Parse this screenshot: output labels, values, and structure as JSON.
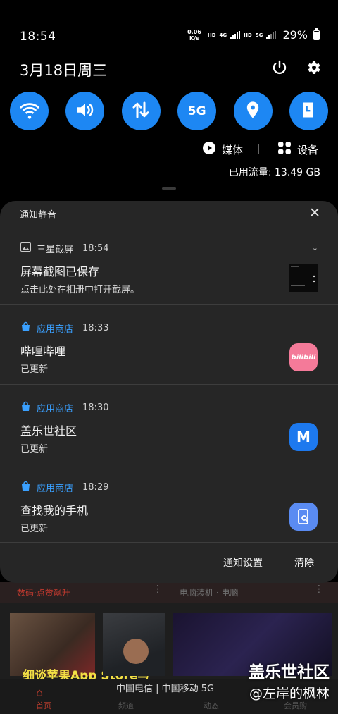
{
  "status_bar": {
    "time": "18:54",
    "net_speed_value": "0.06",
    "net_speed_unit": "K/s",
    "hd1": "HD",
    "sig1": "4G",
    "hd2": "HD",
    "sig2": "5G",
    "battery_percent": "29%"
  },
  "header": {
    "date": "3月18日周三",
    "power_icon": "power-icon",
    "settings_icon": "gear-icon"
  },
  "quick_tiles": [
    {
      "name": "wifi",
      "icon": "wifi-icon"
    },
    {
      "name": "sound",
      "icon": "volume-icon"
    },
    {
      "name": "mobile-data",
      "icon": "data-transfer-icon"
    },
    {
      "name": "5g",
      "label": "5G"
    },
    {
      "name": "location",
      "icon": "location-pin-icon"
    },
    {
      "name": "portrait-lock",
      "icon": "portrait-lock-icon"
    }
  ],
  "media_row": {
    "media_label": "媒体",
    "devices_label": "设备",
    "data_usage": "已用流量: 13.49 GB"
  },
  "colors": {
    "accent": "#1d87f3",
    "panel_bg": "#262626",
    "app_store_blue": "#3aa0ff"
  },
  "panel": {
    "title": "通知静音",
    "notifications": [
      {
        "app": "三星截屏",
        "time": "18:54",
        "title": "屏幕截图已保存",
        "text": "点击此处在相册中打开截屏。",
        "app_color": "#dddddd"
      },
      {
        "app": "应用商店",
        "time": "18:33",
        "title": "哔哩哔哩",
        "text": "已更新",
        "app_color": "#3aa0ff",
        "badge_text": "bilibili"
      },
      {
        "app": "应用商店",
        "time": "18:30",
        "title": "盖乐世社区",
        "text": "已更新",
        "app_color": "#3aa0ff",
        "badge_text": "M"
      },
      {
        "app": "应用商店",
        "time": "18:29",
        "title": "查找我的手机",
        "text": "已更新",
        "app_color": "#3aa0ff"
      }
    ],
    "actions": {
      "settings": "通知设置",
      "clear": "清除"
    }
  },
  "background_app": {
    "tag1": "数码·点赞飙升",
    "tag2": "电脑装机 · 电脑",
    "dots": "⋮",
    "thumb_text": "细谈苹果App Store与",
    "nav": [
      "首页",
      "频道",
      "动态",
      "会员购"
    ],
    "carrier": "中国电信 | 中国移动 5G",
    "watermark_title": "盖乐世社区",
    "watermark_sub": "@左岸的枫林"
  }
}
